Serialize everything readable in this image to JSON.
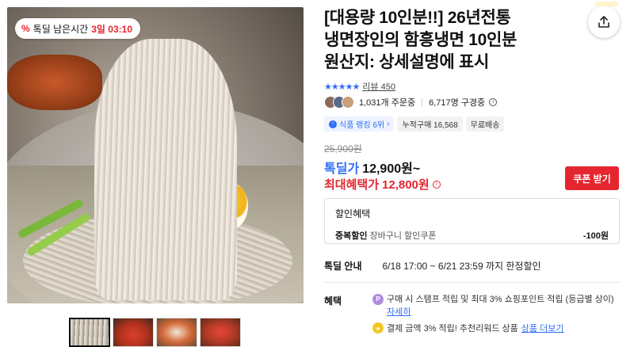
{
  "timer": {
    "label": "톡딜 남은시간",
    "value": "3일 03:10"
  },
  "thumbnails": [
    "t1",
    "t2",
    "t3",
    "t4"
  ],
  "product": {
    "title_line1": "[대용량 10인분!!] 26년전통",
    "title_line2": "냉면장인의 함흥냉면 10인분",
    "title_line3": "원산지: 상세설명에 표시"
  },
  "rating": {
    "stars": "★★★★★",
    "review_label": "리뷰 450"
  },
  "orders": {
    "ordering": "1,031개 주문중",
    "watching": "6,717명 구경중"
  },
  "tags": {
    "rank": "식품 랭킹 6위",
    "cumulative": "누적구매 16,568",
    "shipping": "무료배송"
  },
  "price": {
    "original": "25,900원",
    "deal_label": "톡딜가",
    "deal_price": "12,900원~",
    "max_label": "최대혜택가",
    "max_price": "12,800원",
    "coupon_button": "쿠폰 받기"
  },
  "discount": {
    "title": "할인혜택",
    "row_label": "중복할인",
    "row_desc": "장바구니 할인쿠폰",
    "row_amount": "-100원"
  },
  "notice": {
    "label": "톡딜 안내",
    "value": "6/18 17:00 ~ 6/21 23:59 까지 한정할인"
  },
  "benefit": {
    "label": "혜택",
    "line1": "구매 시 스탬프 적립 및 최대 3% 쇼핑포인트 적립 (등급별 상이)",
    "line1_link": "자세히",
    "line2": "결제 금액 3% 적립! 추천리워드 상품",
    "line2_link": "상품 더보기"
  },
  "colors": {
    "accent_blue": "#2f6df6",
    "accent_red": "#e5262f"
  }
}
